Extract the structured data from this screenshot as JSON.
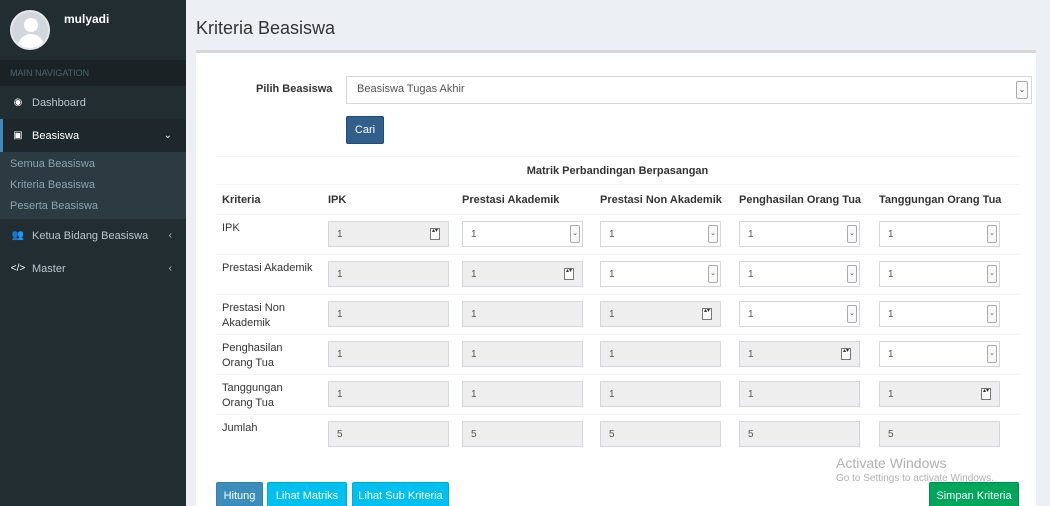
{
  "sidebar": {
    "username": "mulyadi",
    "nav_header": "MAIN NAVIGATION",
    "items": [
      {
        "label": "Dashboard"
      },
      {
        "label": "Beasiswa"
      },
      {
        "label": "Ketua Bidang Beasiswa"
      },
      {
        "label": "Master"
      }
    ],
    "submenu": [
      "Semua Beasiswa",
      "Kriteria Beasiswa",
      "Peserta Beasiswa"
    ]
  },
  "page": {
    "title": "Kriteria Beasiswa",
    "pilih_label": "Pilih Beasiswa",
    "pilih_value": "Beasiswa Tugas Akhir",
    "cari_button": "Cari"
  },
  "table": {
    "title": "Matrik Perbandingan Berpasangan",
    "headers": [
      "Kriteria",
      "IPK",
      "Prestasi Akademik",
      "Prestasi Non Akademik",
      "Penghasilan Orang Tua",
      "Tanggungan Orang Tua"
    ],
    "rows": [
      {
        "label": "IPK",
        "values": [
          "1",
          "1",
          "1",
          "1",
          "1"
        ]
      },
      {
        "label": "Prestasi Akademik",
        "values": [
          "1",
          "1",
          "1",
          "1",
          "1"
        ]
      },
      {
        "label": "Prestasi Non Akademik",
        "values": [
          "1",
          "1",
          "1",
          "1",
          "1"
        ]
      },
      {
        "label": "Penghasilan Orang Tua",
        "values": [
          "1",
          "1",
          "1",
          "1",
          "1"
        ]
      },
      {
        "label": "Tanggungan Orang Tua",
        "values": [
          "1",
          "1",
          "1",
          "1",
          "1"
        ]
      },
      {
        "label": "Jumlah",
        "values": [
          "5",
          "5",
          "5",
          "5",
          "5"
        ]
      }
    ]
  },
  "buttons": {
    "hitung": "Hitung",
    "lihat_matriks": "Lihat Matriks",
    "lihat_sub_kriteria": "Lihat Sub Kriteria",
    "simpan_kriteria": "Simpan Kriteria"
  },
  "watermark": {
    "line1": "Activate Windows",
    "line2": "Go to Settings to activate Windows."
  }
}
